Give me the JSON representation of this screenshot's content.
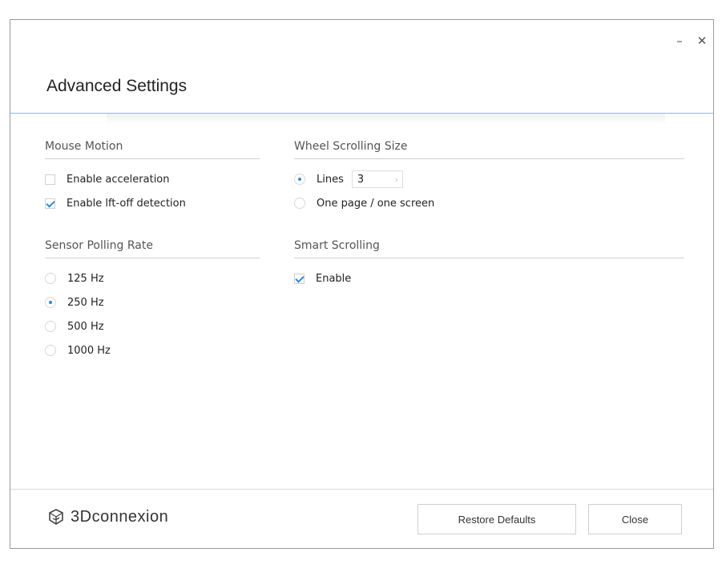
{
  "window": {
    "title": "Advanced Settings",
    "minimize_glyph": "–",
    "close_glyph": "✕"
  },
  "mouse_motion": {
    "header": "Mouse Motion",
    "items": [
      {
        "label": "Enable acceleration",
        "checked": false
      },
      {
        "label": "Enable lft-off detection",
        "checked": true
      }
    ]
  },
  "sensor_polling": {
    "header": "Sensor Polling Rate",
    "options": [
      {
        "label": "125 Hz",
        "selected": false
      },
      {
        "label": "250 Hz",
        "selected": true
      },
      {
        "label": "500 Hz",
        "selected": false
      },
      {
        "label": "1000 Hz",
        "selected": false
      }
    ]
  },
  "wheel_scrolling": {
    "header": "Wheel Scrolling Size",
    "lines_label": "Lines",
    "lines_value": "3",
    "lines_selected": true,
    "page_label": "One page / one screen",
    "page_selected": false
  },
  "smart_scrolling": {
    "header": "Smart Scrolling",
    "enable_label": "Enable",
    "enabled": true
  },
  "footer": {
    "brand": "3Dconnexion",
    "restore_label": "Restore Defaults",
    "close_label": "Close"
  },
  "colors": {
    "accent": "#2f8ad6",
    "title_rule": "#7fc4dd"
  },
  "icons": {
    "spinner_arrow": "chevron-right-icon",
    "logo": "3dconnexion-logo-icon"
  }
}
